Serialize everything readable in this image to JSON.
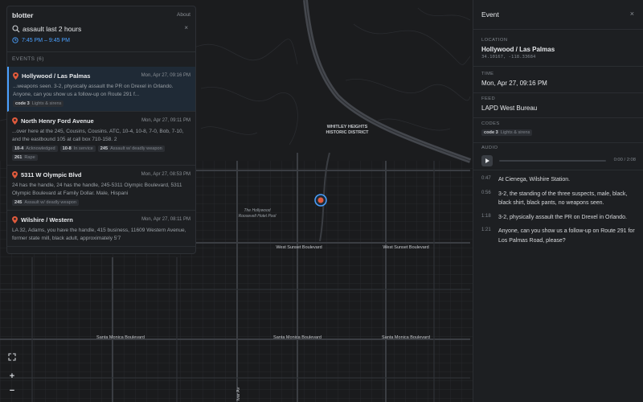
{
  "app": {
    "name": "blotter",
    "about_label": "About"
  },
  "search": {
    "value": "assault last 2 hours",
    "clear_glyph": "×"
  },
  "time_range": "7:45 PM – 9:45 PM",
  "events_header": "EVENTS (6)",
  "events": [
    {
      "title": "Hollywood / Las Palmas",
      "time": "Mon, Apr 27, 09:16 PM",
      "text": "...weapons seen. 3-2, physically assault the PR on Drexel in Orlando. Anyone, can you show us a follow-up on Route 291 f...",
      "tags": [
        {
          "code": "code 3",
          "desc": "Lights & sirens"
        }
      ],
      "selected": true
    },
    {
      "title": "North Henry Ford Avenue",
      "time": "Mon, Apr 27, 09:11 PM",
      "text": "...over here at the 245, Cousins, Cousins. ATC, 10-4, 10-8, 7-0, Bob, 7-10, and the eastbound 105 at call box 710-158. 2",
      "tags": [
        {
          "code": "10-4",
          "desc": "Acknowledged"
        },
        {
          "code": "10-8",
          "desc": "In service"
        },
        {
          "code": "245",
          "desc": "Assault w/ deadly weapon"
        },
        {
          "code": "261",
          "desc": "Rape"
        }
      ]
    },
    {
      "title": "5311 W Olympic Blvd",
      "time": "Mon, Apr 27, 08:53 PM",
      "text": "24 has the handle, 24 has the handle, 245-5311 Olympic Boulevard, 5311 Olympic Boulevard at Family Dollar. Male, Hispani",
      "tags": [
        {
          "code": "245",
          "desc": "Assault w/ deadly weapon"
        }
      ]
    },
    {
      "title": "Wilshire / Western",
      "time": "Mon, Apr 27, 08:11 PM",
      "text": "LA 32, Adams, you have the handle, 415 business, 11609 Western Avenue, former state mill, black adult, approximately 5'7",
      "tags": []
    }
  ],
  "detail": {
    "header": "Event",
    "close_glyph": "×",
    "location_label": "LOCATION",
    "location": "Hollywood / Las Palmas",
    "coords": "34.10167, -118.33684",
    "time_label": "TIME",
    "time": "Mon, Apr 27, 09:16 PM",
    "feed_label": "FEED",
    "feed": "LAPD West Bureau",
    "codes_label": "CODES",
    "codes": [
      {
        "code": "code 3",
        "desc": "Lights & sirens"
      }
    ],
    "audio_label": "AUDIO",
    "audio_time": "0:00 / 2:08",
    "audio_progress": 0,
    "transcript": [
      {
        "ts": "0:47",
        "text": "At Cienega, Wilshire Station."
      },
      {
        "ts": "0:56",
        "text": "3-2, the standing of the three suspects, male, black, black shirt, black pants, no weapons seen."
      },
      {
        "ts": "1:18",
        "text": "3-2, physically assault the PR on Drexel in Orlando."
      },
      {
        "ts": "1:21",
        "text": "Anyone, can you show us a follow-up on Route 291 for Los Palmas Road, please?"
      }
    ]
  },
  "map": {
    "district_label_1": "WHITLEY HEIGHTS",
    "district_label_2": "HISTORIC DISTRICT",
    "poi_1": "The Hollywood",
    "poi_2": "Roosevelt Hotel Pool",
    "street_sunset_1": "West Sunset Boulevard",
    "street_sunset_2": "West Sunset Boulevard",
    "street_sm_1": "Santa Monica Boulevard",
    "street_sm_2": "Santa Monica Boulevard",
    "street_sm_3": "Santa Monica Boulevard",
    "street_ivar": "Ivar Av",
    "marker_color": "#e05a3c",
    "accent": "#4aa0ff"
  },
  "map_controls": {
    "fullscreen_icon": "fullscreen-icon",
    "zoom_in": "+",
    "zoom_out": "−"
  }
}
